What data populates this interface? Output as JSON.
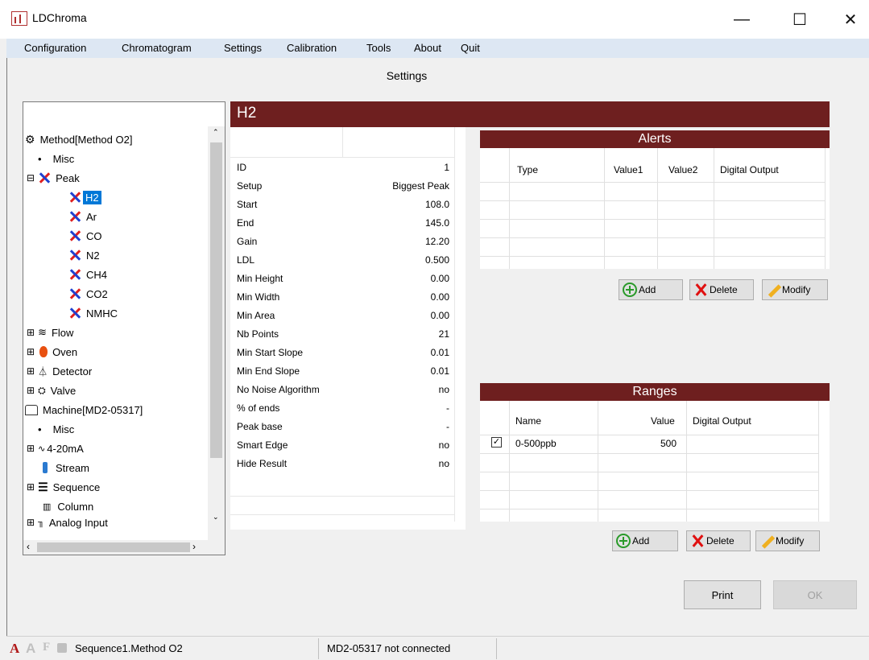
{
  "window": {
    "title": "LDChroma",
    "minimize": "—",
    "maximize": "☐",
    "close": "✕"
  },
  "menu": [
    "Configuration",
    "Chromatogram",
    "Settings",
    "Calibration",
    "Tools",
    "About",
    "Quit"
  ],
  "page_heading": "Settings",
  "tree": {
    "method": "Method[Method O2]",
    "misc1": "Misc",
    "peak": "Peak",
    "peaks": [
      "H2",
      "Ar",
      "CO",
      "N2",
      "CH4",
      "CO2",
      "NMHC"
    ],
    "flow": "Flow",
    "oven": "Oven",
    "detector": "Detector",
    "valve": "Valve",
    "machine": "Machine[MD2-05317]",
    "misc2": "Misc",
    "ma": "4-20mA",
    "stream": "Stream",
    "sequence": "Sequence",
    "column": "Column",
    "analog": "Analog Input",
    "collapse_glyph": "⊟",
    "expand_glyph": "⊞",
    "bullet": "•"
  },
  "peak_title": "H2",
  "params": [
    {
      "name": "ID",
      "value": "1"
    },
    {
      "name": "Setup",
      "value": "Biggest Peak"
    },
    {
      "name": "Start",
      "value": "108.0"
    },
    {
      "name": "End",
      "value": "145.0"
    },
    {
      "name": "Gain",
      "value": "12.20"
    },
    {
      "name": "LDL",
      "value": "0.500"
    },
    {
      "name": "Min Height",
      "value": "0.00"
    },
    {
      "name": "Min Width",
      "value": "0.00"
    },
    {
      "name": "Min Area",
      "value": "0.00"
    },
    {
      "name": "Nb Points",
      "value": "21"
    },
    {
      "name": "Min Start Slope",
      "value": "0.01"
    },
    {
      "name": "Min End Slope",
      "value": "0.01"
    },
    {
      "name": "No Noise Algorithm",
      "value": "no"
    },
    {
      "name": "% of ends",
      "value": "-"
    },
    {
      "name": "Peak base",
      "value": "-"
    },
    {
      "name": "Smart Edge",
      "value": "no"
    },
    {
      "name": "Hide Result",
      "value": "no"
    }
  ],
  "alerts": {
    "title": "Alerts",
    "headers": [
      "Type",
      "Value1",
      "Value2",
      "Digital Output"
    ]
  },
  "ranges": {
    "title": "Ranges",
    "headers": [
      "Name",
      "Value",
      "Digital Output"
    ],
    "rows": [
      {
        "checked": true,
        "name": "0-500ppb",
        "value": "500",
        "output": ""
      }
    ]
  },
  "buttons": {
    "add": "Add",
    "delete": "Delete",
    "modify": "Modify",
    "print": "Print",
    "ok": "OK"
  },
  "status": {
    "glyphs": [
      "A",
      "A",
      "F"
    ],
    "sequence": "Sequence1.Method O2",
    "connection": "MD2-05317 not connected"
  },
  "colors": {
    "accent": "#6e1f1f",
    "selection": "#0078d7",
    "menubar": "#dde7f3"
  }
}
